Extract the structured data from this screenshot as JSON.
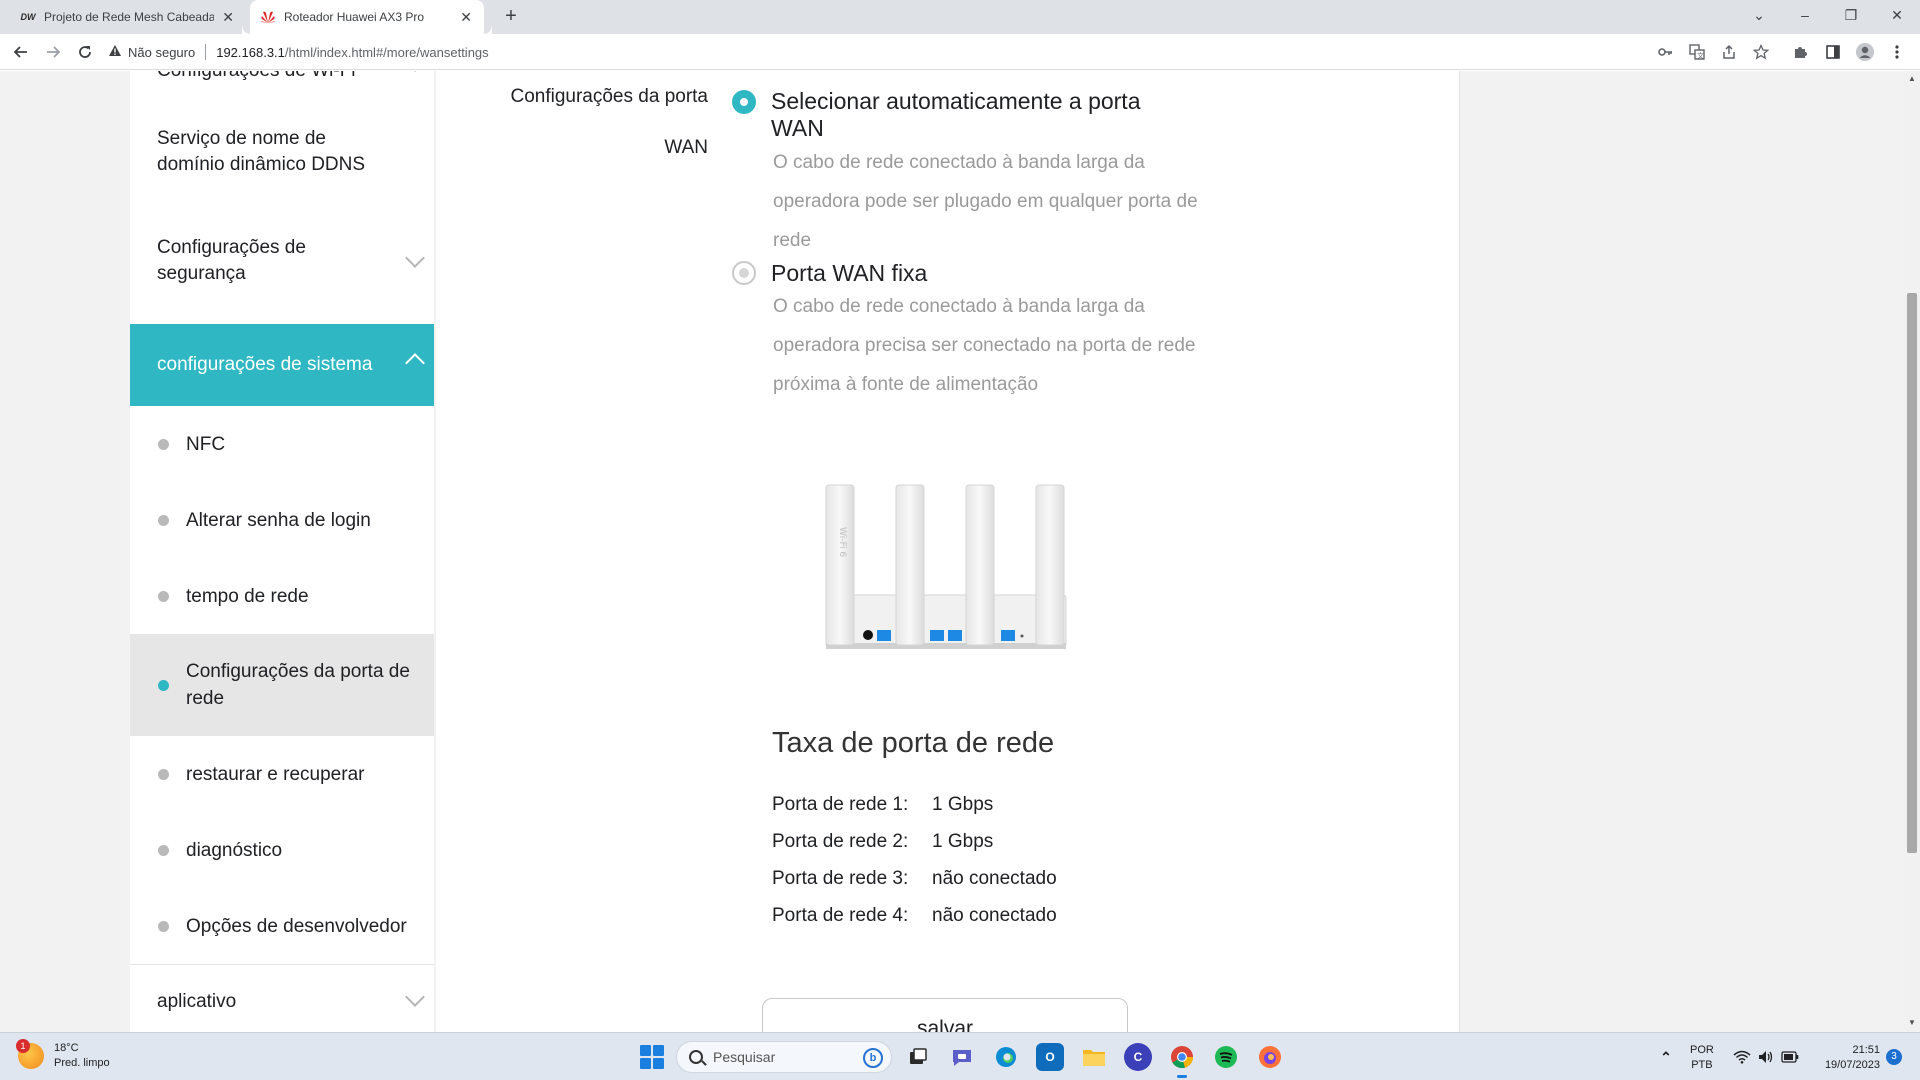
{
  "browser": {
    "tabs": [
      {
        "title": "Projeto de Rede Mesh Cabeada - ",
        "favicon": "DW"
      },
      {
        "title": "Roteador Huawei AX3 Pro"
      }
    ],
    "new_tab": "+",
    "window_controls": {
      "dropdown": "⌄",
      "minimize": "–",
      "restore": "❐",
      "close": "✕"
    },
    "security_label": "Não seguro",
    "url_host": "192.168.3.1",
    "url_path": "/html/index.html#/more/wansettings"
  },
  "sidebar": {
    "partial_top": "Configurações de Wi-Fi",
    "items": [
      {
        "label": "Serviço de nome de domínio dinâmico DDNS"
      },
      {
        "label": "Configurações de segurança"
      },
      {
        "label": "configurações de sistema"
      }
    ],
    "subitems": [
      {
        "label": "NFC"
      },
      {
        "label": "Alterar senha de login"
      },
      {
        "label": "tempo de rede"
      },
      {
        "label": "Configurações da porta de rede"
      },
      {
        "label": "restaurar e recuperar"
      },
      {
        "label": "diagnóstico"
      },
      {
        "label": "Opções de desenvolvedor"
      }
    ],
    "bottom_item": {
      "label": "aplicativo"
    }
  },
  "wan": {
    "field_label_line1": "Configurações da porta",
    "field_label_line2": "WAN",
    "options": [
      {
        "title": "Selecionar automaticamente a porta WAN",
        "description": "O cabo de rede conectado à banda larga da operadora pode ser plugado em qualquer porta de rede",
        "selected": true
      },
      {
        "title": "Porta WAN fixa",
        "description": "O cabo de rede conectado à banda larga da operadora precisa ser conectado na porta de rede próxima à fonte de alimentação",
        "selected": false
      }
    ]
  },
  "port_rates": {
    "title": "Taxa de porta de rede",
    "rows": [
      {
        "label": "Porta de rede 1:",
        "value": "1 Gbps"
      },
      {
        "label": "Porta de rede 2:",
        "value": "1 Gbps"
      },
      {
        "label": "Porta de rede 3:",
        "value": "não conectado"
      },
      {
        "label": "Porta de rede 4:",
        "value": "não conectado"
      }
    ]
  },
  "save_button": "salvar",
  "colors": {
    "accent": "#2fb8c3",
    "port_blue": "#1e88e5"
  },
  "taskbar": {
    "weather_temp": "18°C",
    "weather_text": "Pred. limpo",
    "weather_badge": "1",
    "search_placeholder": "Pesquisar",
    "lang_line1": "POR",
    "lang_line2": "PTB",
    "time": "21:51",
    "date": "19/07/2023",
    "notifications": "3"
  }
}
